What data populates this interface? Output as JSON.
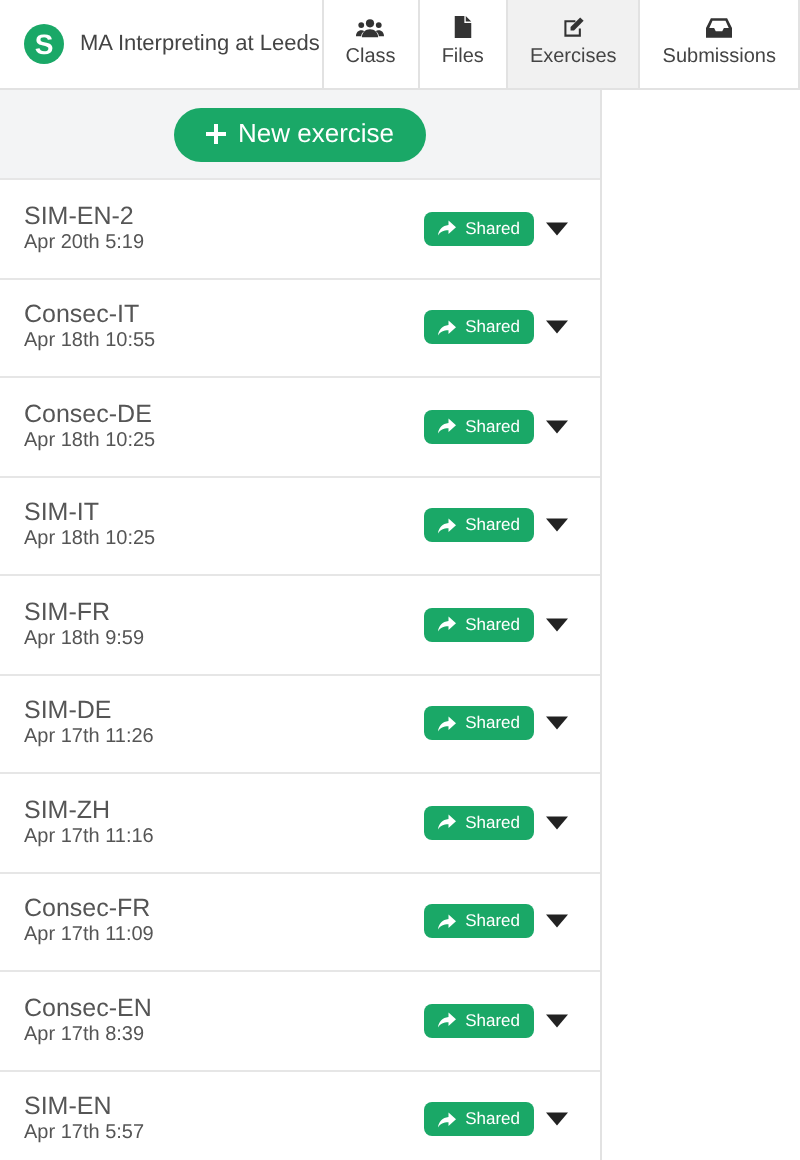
{
  "brand": {
    "title": "MA Interpreting at Leeds",
    "logo": "S"
  },
  "tabs": [
    {
      "label": "Class",
      "kind": "class",
      "selected": false
    },
    {
      "label": "Files",
      "kind": "files",
      "selected": false
    },
    {
      "label": "Exercises",
      "kind": "exercises",
      "selected": true
    },
    {
      "label": "Submissions",
      "kind": "submissions",
      "selected": false
    }
  ],
  "new_button": "New exercise",
  "exercises": [
    {
      "name": "SIM-EN-2",
      "date": "Apr 20th 5:19",
      "status": "Shared"
    },
    {
      "name": "Consec-IT",
      "date": "Apr 18th 10:55",
      "status": "Shared"
    },
    {
      "name": "Consec-DE",
      "date": "Apr 18th 10:25",
      "status": "Shared"
    },
    {
      "name": "SIM-IT",
      "date": "Apr 18th 10:25",
      "status": "Shared"
    },
    {
      "name": "SIM-FR",
      "date": "Apr 18th 9:59",
      "status": "Shared"
    },
    {
      "name": "SIM-DE",
      "date": "Apr 17th 11:26",
      "status": "Shared"
    },
    {
      "name": "SIM-ZH",
      "date": "Apr 17th 11:16",
      "status": "Shared"
    },
    {
      "name": "Consec-FR",
      "date": "Apr 17th 11:09",
      "status": "Shared"
    },
    {
      "name": "Consec-EN",
      "date": "Apr 17th 8:39",
      "status": "Shared"
    },
    {
      "name": "SIM-EN",
      "date": "Apr 17th 5:57",
      "status": "Shared"
    }
  ]
}
